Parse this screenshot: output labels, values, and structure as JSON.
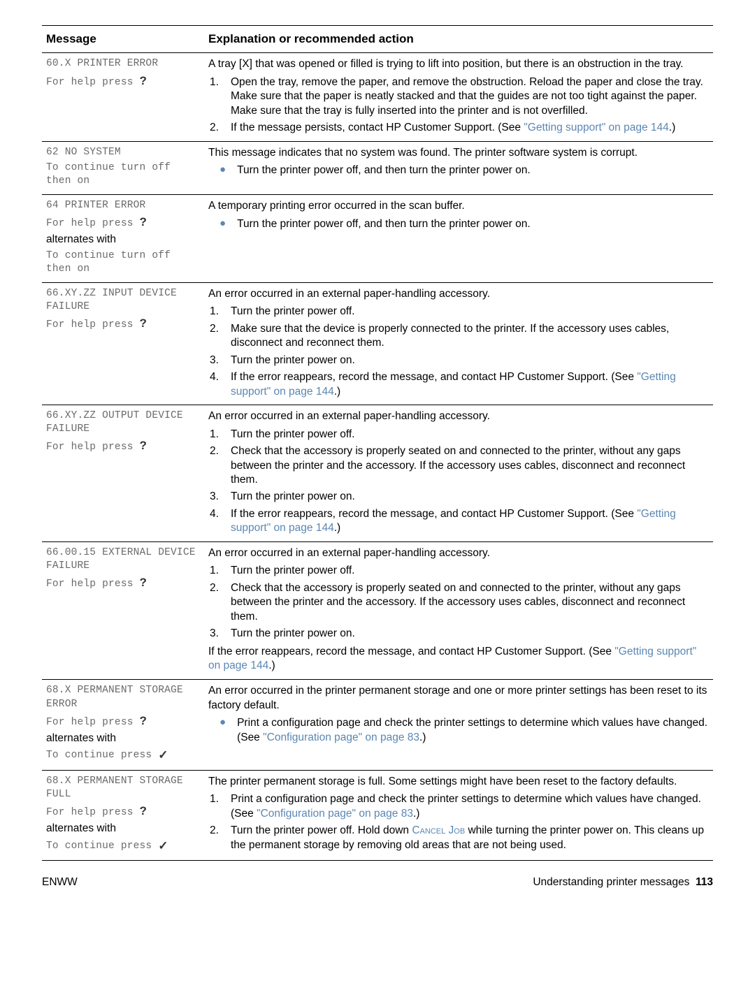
{
  "header": {
    "col1": "Message",
    "col2": "Explanation or recommended action"
  },
  "footer": {
    "left": "ENWW",
    "right_label": "Understanding printer messages",
    "right_page": "113"
  },
  "common": {
    "for_help": "For help press ",
    "alternates": "alternates with",
    "continue_off": "To continue turn off then on",
    "continue_press": "To continue press ",
    "qmark": "?",
    "check": "✓"
  },
  "links": {
    "getting_support_inline": "\"Getting support\" on page 144",
    "getting_support_wrap1": "\"Getting support\" on page 144",
    "getting_prefix": "\"Getting",
    "support_suffix": "support\" on page 144",
    "config_page": "\"Configuration page\" on page 83",
    "cancel_job": "Cancel Job"
  },
  "rows": [
    {
      "msg": {
        "line1": "60.X PRINTER ERROR"
      },
      "exp": {
        "intro": "A tray [X] that was opened or filled is trying to lift into position, but there is an obstruction in the tray.",
        "list": [
          {
            "n": "1.",
            "text": "Open the tray, remove the paper, and remove the obstruction. Reload the paper and close the tray. Make sure that the paper is neatly stacked and that the guides are not too tight against the paper. Make sure that the tray is fully inserted into the printer and is not overfilled."
          },
          {
            "n": "2.",
            "text_a": "If the message persists, contact HP Customer Support. (See ",
            "text_b": ".)"
          }
        ]
      }
    },
    {
      "msg": {
        "line1": "62 NO SYSTEM"
      },
      "exp": {
        "intro": "This message indicates that no system was found. The printer software system is corrupt.",
        "bullets": [
          {
            "text": "Turn the printer power off, and then turn the printer power on."
          }
        ]
      }
    },
    {
      "msg": {
        "line1": "64 PRINTER ERROR",
        "alt": true
      },
      "exp": {
        "intro": "A temporary printing error occurred in the scan buffer.",
        "bullets": [
          {
            "text": "Turn the printer power off, and then turn the printer power on."
          }
        ]
      }
    },
    {
      "msg": {
        "line1": "66.XY.ZZ INPUT DEVICE FAILURE"
      },
      "exp": {
        "intro": "An error occurred in an external paper-handling accessory.",
        "list": [
          {
            "n": "1.",
            "text": "Turn the printer power off."
          },
          {
            "n": "2.",
            "text": "Make sure that the device is properly connected to the printer. If the accessory uses cables, disconnect and reconnect them."
          },
          {
            "n": "3.",
            "text": "Turn the printer power on."
          },
          {
            "n": "4.",
            "text_a": "If the error reappears, record the message, and contact HP Customer Support. (See ",
            "text_b": ".)"
          }
        ]
      }
    },
    {
      "msg": {
        "line1": "66.XY.ZZ OUTPUT DEVICE FAILURE"
      },
      "exp": {
        "intro": "An error occurred in an external paper-handling accessory.",
        "list": [
          {
            "n": "1.",
            "text": "Turn the printer power off."
          },
          {
            "n": "2.",
            "text": "Check that the accessory is properly seated on and connected to the printer, without any gaps between the printer and the accessory. If the accessory uses cables, disconnect and reconnect them."
          },
          {
            "n": "3.",
            "text": "Turn the printer power on."
          },
          {
            "n": "4.",
            "text_a": "If the error reappears, record the message, and contact HP Customer Support. (See ",
            "text_b": ".)"
          }
        ]
      }
    },
    {
      "msg": {
        "line1": "66.00.15 EXTERNAL DEVICE FAILURE"
      },
      "exp": {
        "intro": "An error occurred in an external paper-handling accessory.",
        "list": [
          {
            "n": "1.",
            "text": "Turn the printer power off."
          },
          {
            "n": "2.",
            "text": "Check that the accessory is properly seated on and connected to the printer, without any gaps between the printer and the accessory. If the accessory uses cables, disconnect and reconnect them."
          },
          {
            "n": "3.",
            "text": "Turn the printer power on."
          }
        ],
        "tail_a": "If the error reappears, record the message, and contact HP Customer Support. (See ",
        "tail_b": ".)"
      }
    },
    {
      "msg": {
        "line1": "68.X PERMANENT STORAGE ERROR",
        "alt_check": true
      },
      "exp": {
        "intro": "An error occurred in the printer permanent storage and one or more printer settings has been reset to its factory default.",
        "bullets": [
          {
            "text_a": "Print a configuration page and check the printer settings to determine which values have changed. (See ",
            "text_b": ".)"
          }
        ]
      }
    },
    {
      "msg": {
        "line1": "68.X PERMANENT STORAGE FULL",
        "alt_check": true
      },
      "exp": {
        "intro": "The printer permanent storage is full. Some settings might have been reset to the factory defaults.",
        "list": [
          {
            "n": "1.",
            "text_a": "Print a configuration page and check the printer settings to determine which values have changed. (See ",
            "link": "config",
            "text_b": ".)"
          },
          {
            "n": "2.",
            "text_a": "Turn the printer power off. Hold down ",
            "link": "cancel",
            "text_b": " while turning the printer power on. This cleans up the permanent storage by removing old areas that are not being used."
          }
        ]
      }
    }
  ]
}
